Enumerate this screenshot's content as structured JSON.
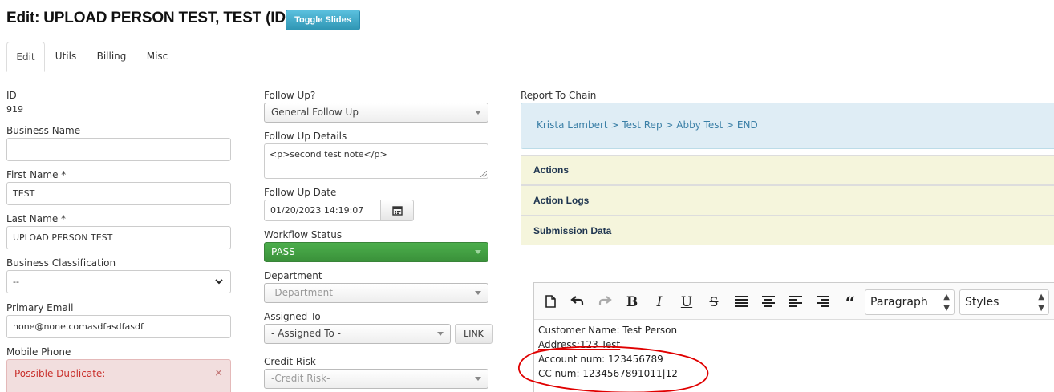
{
  "header": {
    "title": "Edit: UPLOAD PERSON TEST, TEST (ID: 919)",
    "toggle_label": "Toggle Slides"
  },
  "tabs": [
    "Edit",
    "Utils",
    "Billing",
    "Misc"
  ],
  "col1": {
    "id_label": "ID",
    "id_value": "919",
    "business_name_label": "Business Name",
    "business_name_value": "",
    "first_name_label": "First Name *",
    "first_name_value": "TEST",
    "last_name_label": "Last Name *",
    "last_name_value": "UPLOAD PERSON TEST",
    "classification_label": "Business Classification",
    "classification_value": "--",
    "email_label": "Primary Email",
    "email_value": "none@none.comasdfasdfasdf",
    "mobile_label": "Mobile Phone",
    "duplicate_alert": "Possible Duplicate:",
    "alert_close": "×"
  },
  "col2": {
    "follow_up_label": "Follow Up?",
    "follow_up_value": "General Follow Up",
    "details_label": "Follow Up Details",
    "details_value": "<p>second test note</p>",
    "date_label": "Follow Up Date",
    "date_value": "01/20/2023 14:19:07",
    "workflow_label": "Workflow Status",
    "workflow_value": "PASS",
    "department_label": "Department",
    "department_value": "-Department-",
    "assigned_label": "Assigned To",
    "assigned_value": "- Assigned To -",
    "link_label": "LINK",
    "credit_label": "Credit Risk",
    "credit_value": "-Credit Risk-"
  },
  "col3": {
    "report_label": "Report To Chain",
    "report_chain": "Krista Lambert > Test Rep > Abby Test > END",
    "actions_label": "Actions",
    "action_logs_label": "Action Logs",
    "submission_label": "Submission Data"
  },
  "editor": {
    "format_value": "Paragraph",
    "styles_value": "Styles",
    "lines": [
      "Customer Name: Test Person",
      "Address:123 Test",
      "Account num: 123456789",
      "CC num: 1234567891011|12"
    ]
  },
  "colors": {
    "primary_blue": "#2f96b4",
    "pass_green": "#3a913a",
    "info_bg": "#dfedf5",
    "accordion_bg": "#f5f5dc",
    "alert_bg": "#f2dede",
    "annotation_red": "#e00000"
  }
}
